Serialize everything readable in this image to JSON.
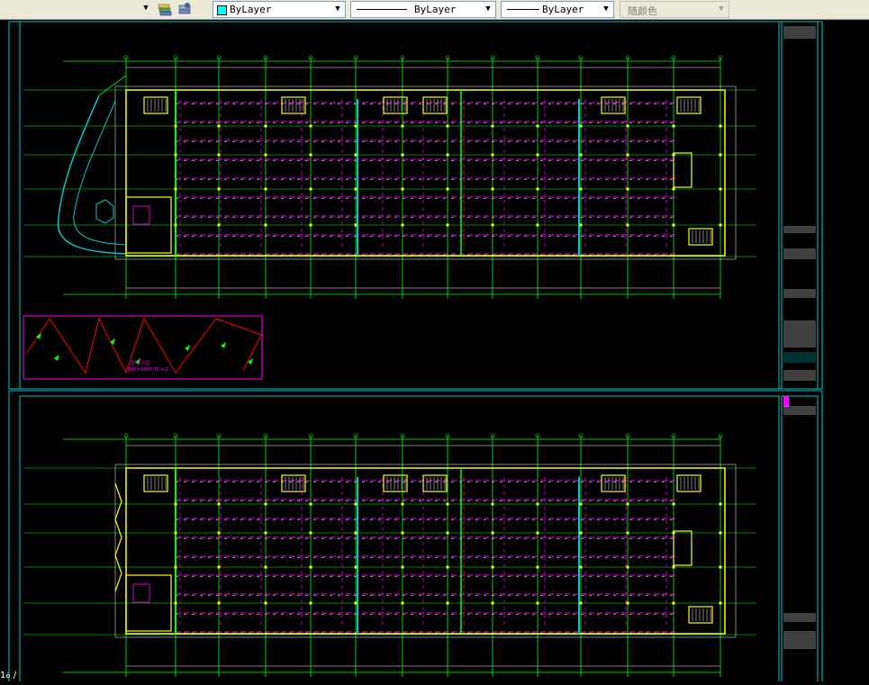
{
  "toolbar": {
    "layer_arrow": "▼",
    "color_control": {
      "value": "ByLayer",
      "swatch": "#00ffff"
    },
    "linetype_control": {
      "value": "ByLayer"
    },
    "lineweight_control": {
      "value": "ByLayer"
    },
    "plotstyle_control": {
      "value": "随颜色",
      "disabled": true
    }
  },
  "drawing": {
    "background": "#000000",
    "frame_color": "#00c8c8",
    "grid_color": "#00ff00",
    "wall_color": "#ffff00",
    "room_color": "#ff00ff",
    "dim_color": "#ffffff",
    "red_line_color": "#ff0000",
    "inset_text_1": "总·防火区",
    "inset_text_2": "面积=4400.75 m2"
  },
  "status_bar": {
    "text": "ة1 /"
  }
}
